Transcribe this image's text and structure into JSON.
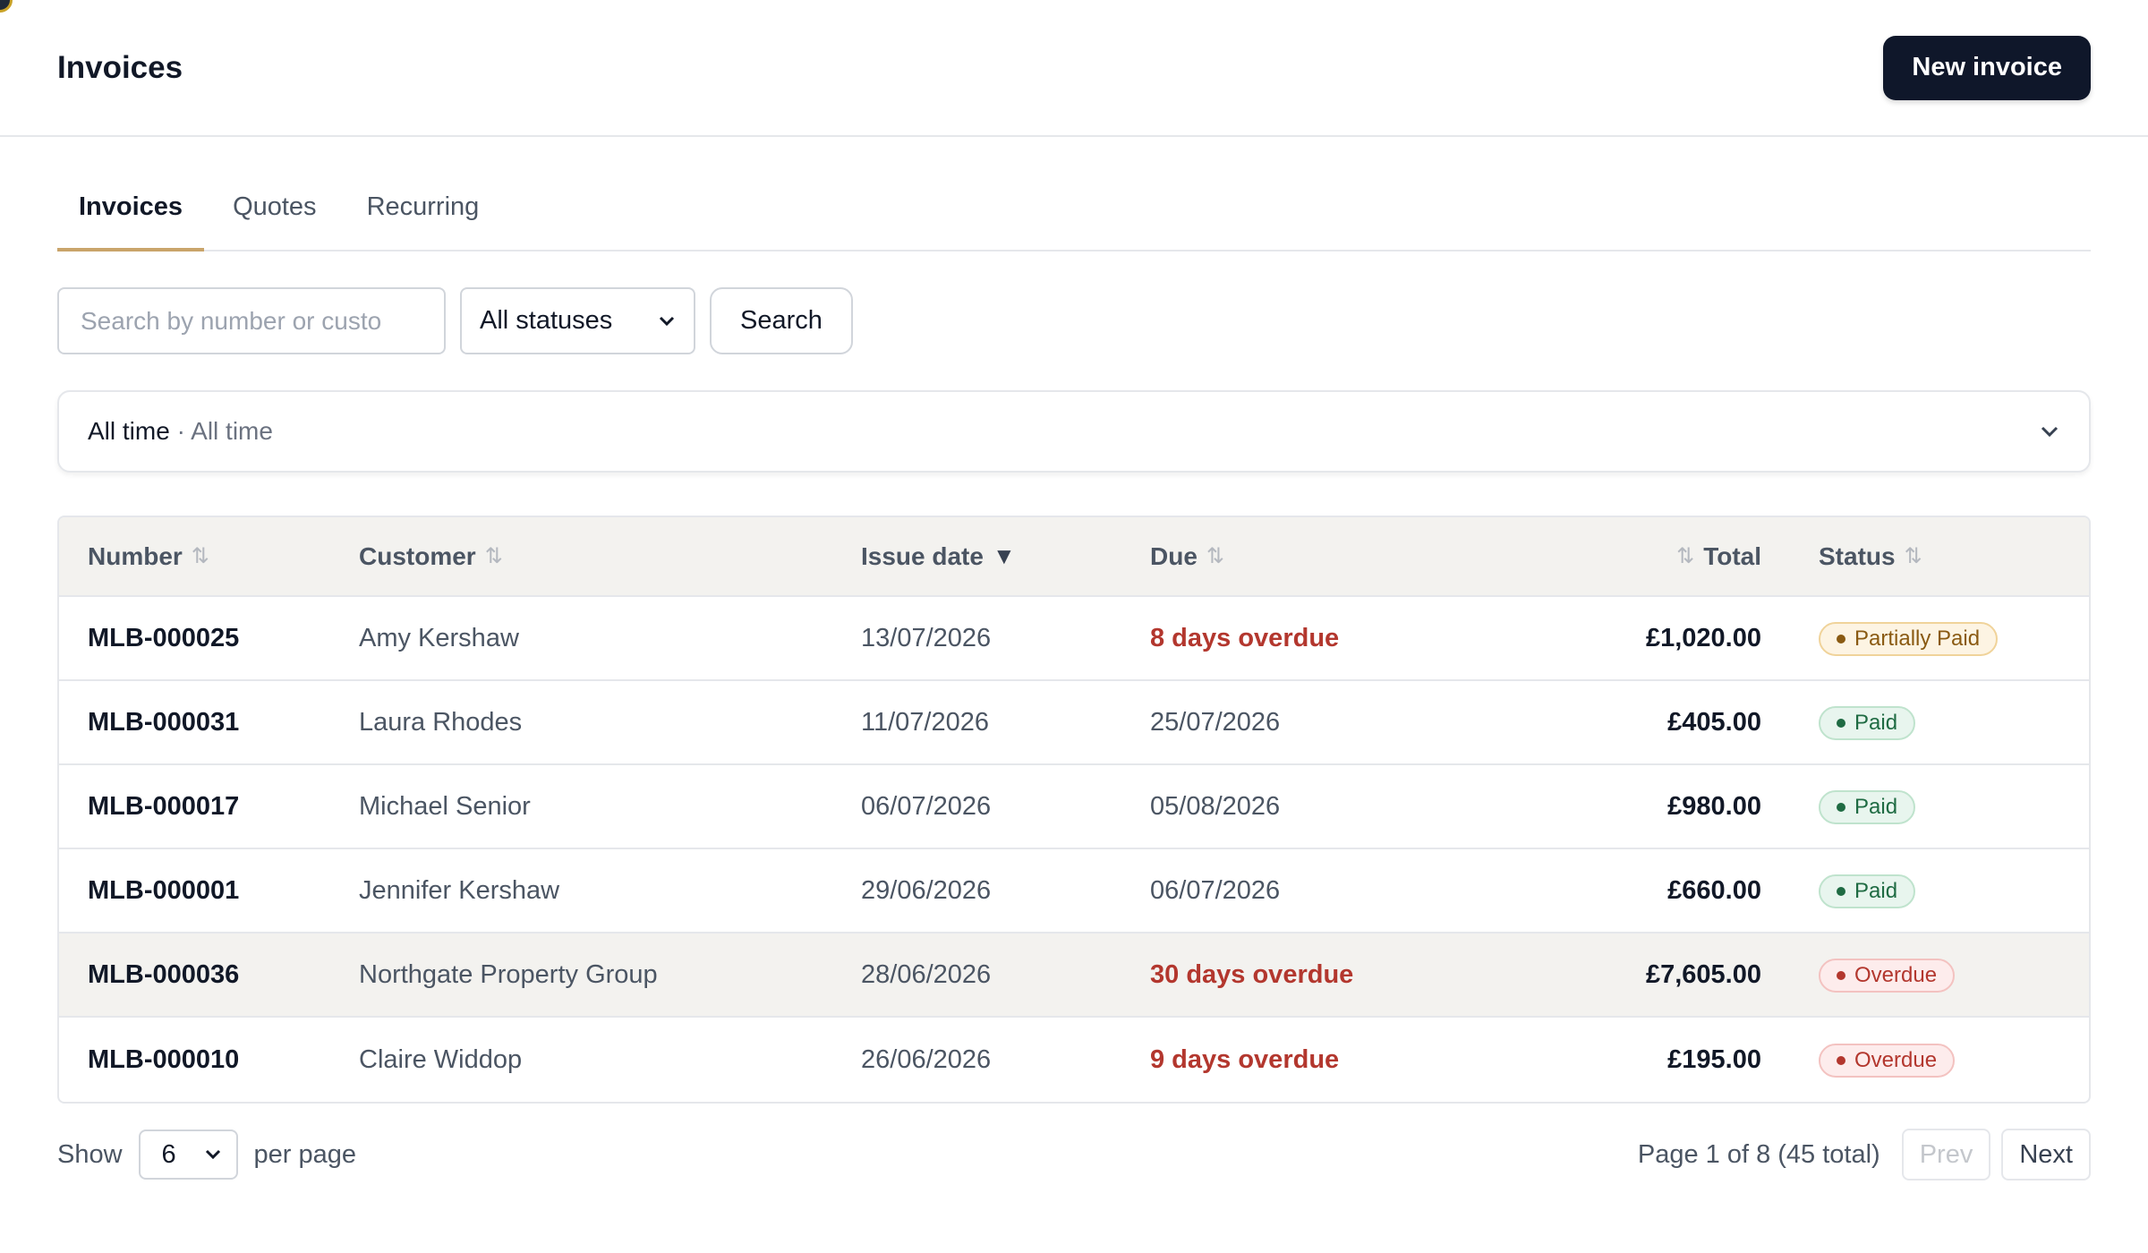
{
  "header": {
    "title": "Invoices",
    "new_button": "New invoice"
  },
  "tabs": [
    {
      "label": "Invoices",
      "active": true
    },
    {
      "label": "Quotes",
      "active": false
    },
    {
      "label": "Recurring",
      "active": false
    }
  ],
  "filters": {
    "search_placeholder": "Search by number or custo",
    "status_value": "All statuses",
    "search_button": "Search"
  },
  "date_range": {
    "primary": "All time",
    "separator": "·",
    "secondary": "All time"
  },
  "table": {
    "columns": {
      "number": "Number",
      "customer": "Customer",
      "issue_date": "Issue date",
      "due": "Due",
      "total": "Total",
      "status": "Status"
    },
    "sorted_column": "issue_date",
    "rows": [
      {
        "number": "MLB-000025",
        "customer": "Amy Kershaw",
        "issue_date": "13/07/2026",
        "due": "8 days overdue",
        "due_overdue": true,
        "total": "£1,020.00",
        "status": "Partially Paid",
        "status_kind": "partial"
      },
      {
        "number": "MLB-000031",
        "customer": "Laura Rhodes",
        "issue_date": "11/07/2026",
        "due": "25/07/2026",
        "due_overdue": false,
        "total": "£405.00",
        "status": "Paid",
        "status_kind": "paid"
      },
      {
        "number": "MLB-000017",
        "customer": "Michael Senior",
        "issue_date": "06/07/2026",
        "due": "05/08/2026",
        "due_overdue": false,
        "total": "£980.00",
        "status": "Paid",
        "status_kind": "paid"
      },
      {
        "number": "MLB-000001",
        "customer": "Jennifer Kershaw",
        "issue_date": "29/06/2026",
        "due": "06/07/2026",
        "due_overdue": false,
        "total": "£660.00",
        "status": "Paid",
        "status_kind": "paid"
      },
      {
        "number": "MLB-000036",
        "customer": "Northgate Property Group",
        "issue_date": "28/06/2026",
        "due": "30 days overdue",
        "due_overdue": true,
        "total": "£7,605.00",
        "status": "Overdue",
        "status_kind": "overdue"
      },
      {
        "number": "MLB-000010",
        "customer": "Claire Widdop",
        "issue_date": "26/06/2026",
        "due": "9 days overdue",
        "due_overdue": true,
        "total": "£195.00",
        "status": "Overdue",
        "status_kind": "overdue"
      }
    ]
  },
  "pagination": {
    "show_label": "Show",
    "per_page_value": "6",
    "per_page_label": "per page",
    "info": "Page 1 of 8 (45 total)",
    "prev": "Prev",
    "next": "Next"
  },
  "colors": {
    "accent": "#c9a46a",
    "primary_button": "#0f172a",
    "overdue": "#b3372e",
    "paid": "#1f6b43",
    "partial": "#8a5a12"
  }
}
